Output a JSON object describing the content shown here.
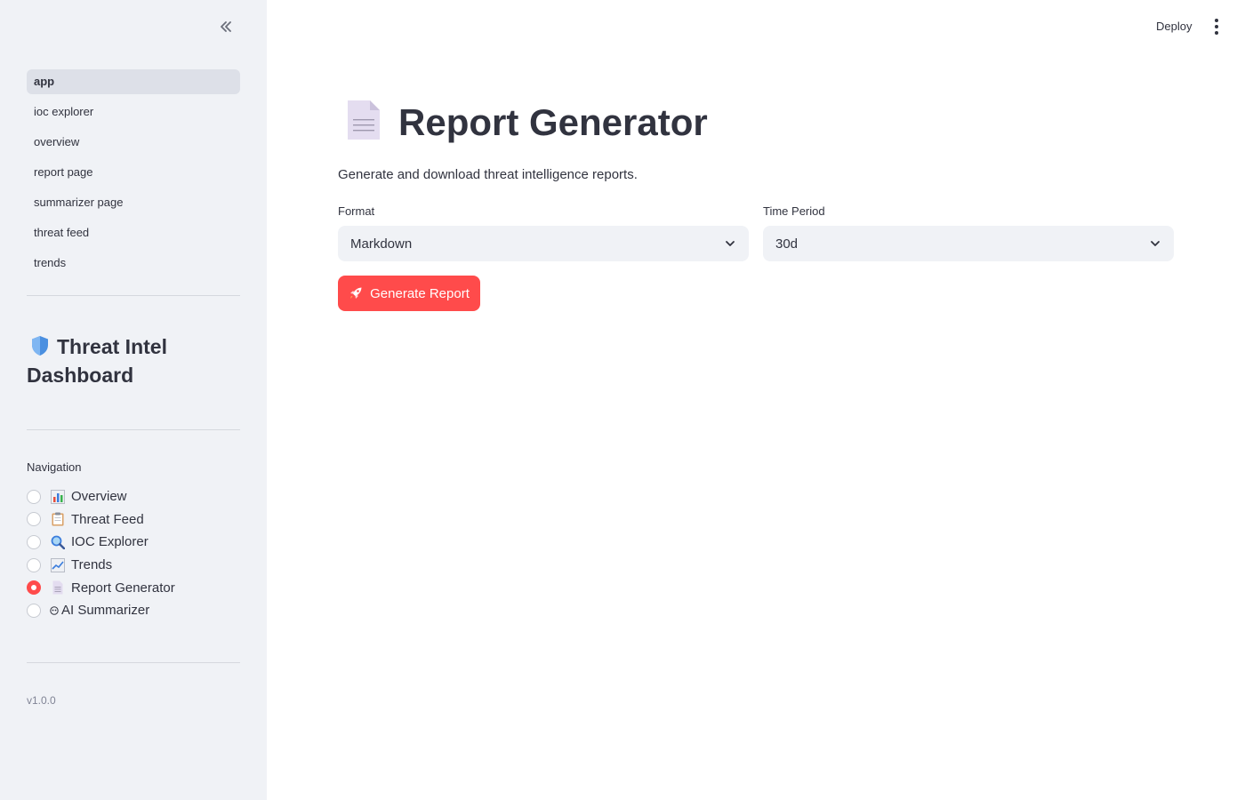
{
  "sidebar": {
    "pages": [
      {
        "label": "app",
        "active": true
      },
      {
        "label": "ioc explorer",
        "active": false
      },
      {
        "label": "overview",
        "active": false
      },
      {
        "label": "report page",
        "active": false
      },
      {
        "label": "summarizer page",
        "active": false
      },
      {
        "label": "threat feed",
        "active": false
      },
      {
        "label": "trends",
        "active": false
      }
    ],
    "title_line1": "Threat Intel",
    "title_line2": "Dashboard",
    "navigation_label": "Navigation",
    "navigation_options": [
      {
        "label": "Overview",
        "icon": "bar-chart-icon",
        "selected": false
      },
      {
        "label": "Threat Feed",
        "icon": "clipboard-icon",
        "selected": false
      },
      {
        "label": "IOC Explorer",
        "icon": "magnifier-icon",
        "selected": false
      },
      {
        "label": "Trends",
        "icon": "trend-chart-icon",
        "selected": false
      },
      {
        "label": "Report Generator",
        "icon": "document-icon",
        "selected": true
      },
      {
        "label": "AI Summarizer",
        "icon": "ai-icon",
        "selected": false
      }
    ],
    "version": "v1.0.0"
  },
  "header": {
    "deploy_label": "Deploy"
  },
  "main": {
    "title": "Report Generator",
    "subtitle": "Generate and download threat intelligence reports.",
    "format": {
      "label": "Format",
      "value": "Markdown"
    },
    "time_period": {
      "label": "Time Period",
      "value": "30d"
    },
    "generate_label": "Generate Report"
  },
  "colors": {
    "accent": "#ff4b4b",
    "sidebar_bg": "#f0f2f6",
    "text": "#31333f"
  }
}
